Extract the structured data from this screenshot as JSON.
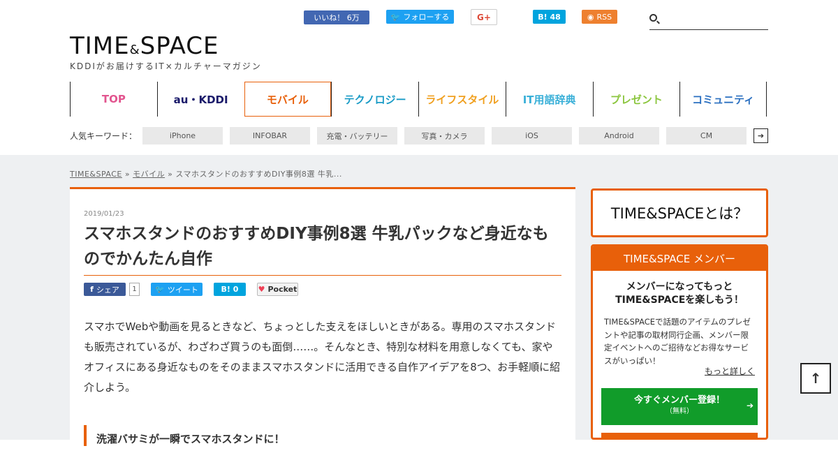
{
  "social": {
    "fb_like": "いいね！ 6万",
    "tw_follow": "フォローする",
    "gplus": "G+",
    "hatena": "B! 48",
    "rss": "RSS"
  },
  "search": {
    "placeholder": ""
  },
  "logo": {
    "main": "TIME",
    "amp": "&",
    "main2": "SPACE",
    "tagline": "KDDIがお届けするIT×カルチャーマガジン"
  },
  "nav": [
    {
      "label": "TOP",
      "color": "#e2558f"
    },
    {
      "label": "au・KDDI",
      "color": "#1a1a6a"
    },
    {
      "label": "モバイル",
      "color": "#e8600a"
    },
    {
      "label": "テクノロジー",
      "color": "#1a9bc6"
    },
    {
      "label": "ライフスタイル",
      "color": "#f0a020"
    },
    {
      "label": "IT用語辞典",
      "color": "#3ab0d8"
    },
    {
      "label": "プレゼント",
      "color": "#8cc63f"
    },
    {
      "label": "コミュニティ",
      "color": "#2a6fc0"
    }
  ],
  "keywords": {
    "label": "人気キーワード：",
    "items": [
      "iPhone",
      "INFOBAR",
      "充電・バッテリー",
      "写真・カメラ",
      "iOS",
      "Android",
      "CM"
    ]
  },
  "breadcrumb": {
    "home": "TIME&SPACE",
    "sep": "»",
    "cat": "モバイル",
    "current": "スマホスタンドのおすすめDIY事例8選 牛乳..."
  },
  "article": {
    "date": "2019/01/23",
    "title": "スマホスタンドのおすすめDIY事例8選 牛乳パックなど身近なものでかんたん自作",
    "share_fb": "シェア",
    "share_count": "1",
    "share_tw": "ツイート",
    "share_hb": "B! 0",
    "share_pocket": "Pocket",
    "lead": "スマホでWebや動画を見るときなど、ちょっとした支えをほしいときがある。専用のスマホスタンドも販売されているが、わざわざ買うのも面倒……。そんなとき、特別な材料を用意しなくても、家やオフィスにある身近なものをそのままスマホスタンドに活用できる自作アイデアを8つ、お手軽順に紹介しよう。",
    "heading": "洗濯バサミが一瞬でスマホスタンドに！"
  },
  "sidebar": {
    "about": "TIME&SPACEとは？",
    "member_head": "TIME&SPACE メンバー",
    "member_lead1": "メンバーになってもっと",
    "member_lead2": "TIME&SPACEを楽しもう！",
    "member_text": "TIME&SPACEで話題のアイテムのプレゼントや記事の取材同行企画、メンバー限定イベントへのご招待などお得なサービスがいっぱい！",
    "more": "もっと詳しく",
    "register": "今すぐメンバー登録！",
    "register_sub": "（無料）"
  },
  "totop": "↑"
}
